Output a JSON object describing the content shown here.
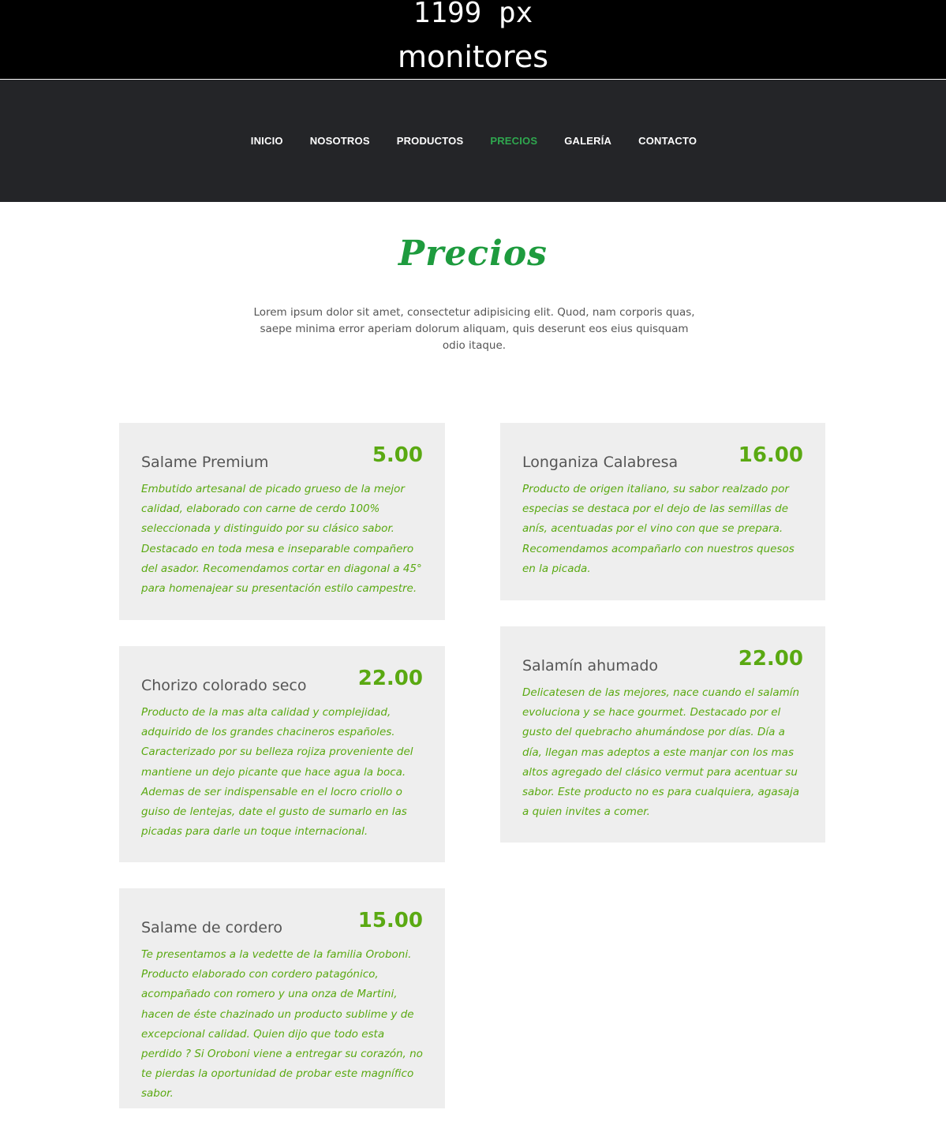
{
  "banner": {
    "line1": "1199 px",
    "line2": "monitores"
  },
  "nav": {
    "items": [
      {
        "label": "INICIO",
        "active": false
      },
      {
        "label": "NOSOTROS",
        "active": false
      },
      {
        "label": "PRODUCTOS",
        "active": false
      },
      {
        "label": "PRECIOS",
        "active": true
      },
      {
        "label": "GALERÍA",
        "active": false
      },
      {
        "label": "CONTACTO",
        "active": false
      }
    ]
  },
  "section": {
    "title": "Precios",
    "intro": "Lorem ipsum dolor sit amet, consectetur adipisicing elit. Quod, nam corporis quas, saepe minima error aperiam dolorum aliquam, quis deserunt eos eius quisquam odio itaque."
  },
  "products": [
    {
      "name": "Salame Premium",
      "price": "5.00",
      "description": "Embutido artesanal de picado grueso de la mejor calidad, elaborado con carne de cerdo 100% seleccionada y distinguido por su clásico sabor. Destacado en toda mesa e inseparable compañero del asador. Recomendamos cortar en diagonal a 45° para homenajear su presentación estilo campestre."
    },
    {
      "name": "Longaniza Calabresa",
      "price": "16.00",
      "description": "Producto de origen italiano, su sabor realzado por especias se destaca por el dejo de las semillas de anís, acentuadas por el vino con que se prepara. Recomendamos acompañarlo con nuestros quesos en la picada."
    },
    {
      "name": "Chorizo colorado seco",
      "price": "22.00",
      "description": "Producto de la mas alta calidad y complejidad, adquirido de los grandes chacineros españoles. Caracterizado por su belleza rojiza proveniente del mantiene un dejo picante que hace agua la boca. Ademas de ser indispensable en el locro criollo o guiso de lentejas, date el gusto de sumarlo en las picadas para darle un toque internacional."
    },
    {
      "name": "Salamín ahumado",
      "price": "22.00",
      "description": "Delicatesen de las mejores, nace cuando el salamín evoluciona y se hace gourmet. Destacado por el gusto del quebracho ahumándose por días. Día a día, llegan mas adeptos a este manjar con los mas altos agregado del clásico vermut para acentuar su sabor. Este producto no es para cualquiera, agasaja a quien invites a comer."
    },
    {
      "name": "Salame de cordero",
      "price": "15.00",
      "description": "Te presentamos a la vedette de la familia Oroboni. Producto elaborado con cordero patagónico, acompañado con romero y una onza de Martini, hacen de éste chazinado un producto sublime y de excepcional calidad. Quien dijo que todo esta perdido ? Si Oroboni viene a entregar su corazón, no te pierdas la oportunidad de probar este magnífico sabor."
    }
  ],
  "colors": {
    "nav_background": "#242528",
    "accent_green": "#1e9b3e",
    "price_green": "#5aa912",
    "card_background": "#eeeeee"
  }
}
